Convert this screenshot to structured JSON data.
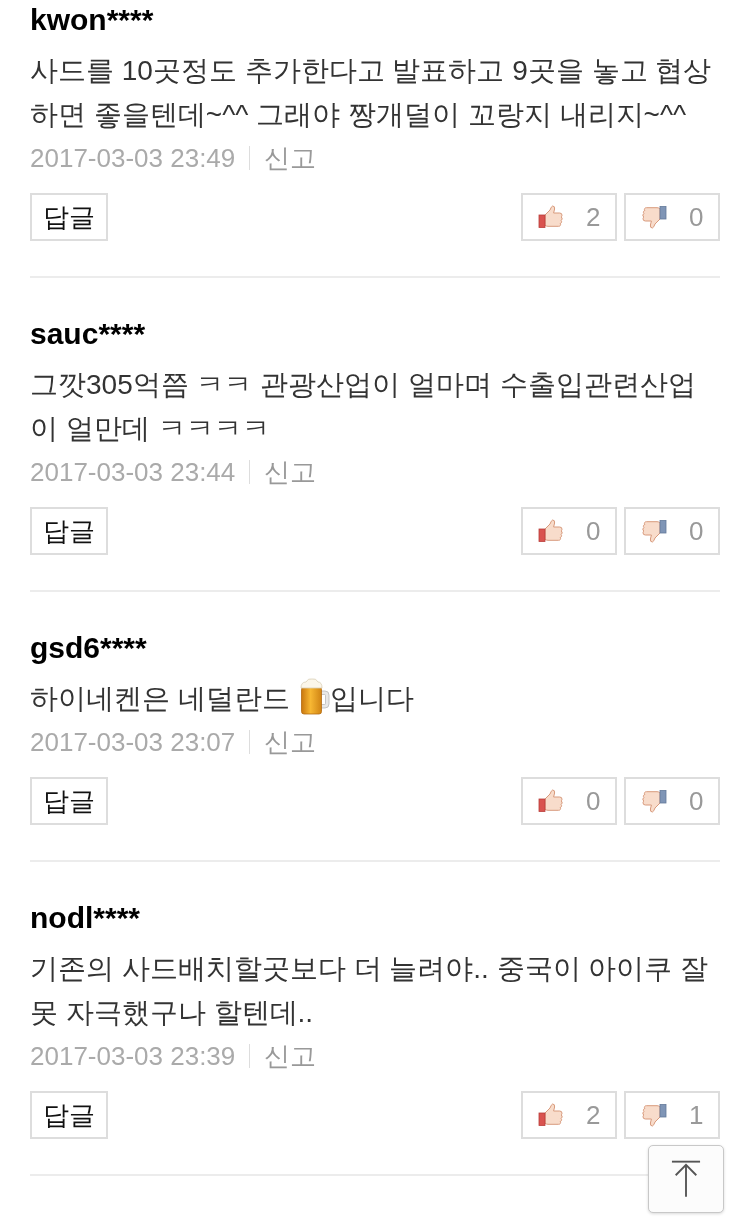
{
  "comments": [
    {
      "username": "kwon****",
      "body": [
        {
          "kind": "text",
          "text": "사드를 10곳정도 추가한다고 발표하고 9곳을 놓고 협상하면 좋을텐데~^^ 그래야 짱개덜이 꼬랑지 내리지~^^"
        }
      ],
      "date": "2017-03-03 23:49",
      "report": "신고",
      "reply": "답글",
      "likes": "2",
      "dislikes": "0"
    },
    {
      "username": "sauc****",
      "body": [
        {
          "kind": "text",
          "text": "그깟305억쯤 ㅋㅋ 관광산업이 얼마며 수출입관련산업이 얼만데 ㅋㅋㅋㅋ"
        }
      ],
      "date": "2017-03-03 23:44",
      "report": "신고",
      "reply": "답글",
      "likes": "0",
      "dislikes": "0"
    },
    {
      "username": "gsd6****",
      "body": [
        {
          "kind": "text",
          "text": "하이네켄은 네덜란드"
        },
        {
          "kind": "emoji"
        },
        {
          "kind": "text",
          "text": "입니다"
        }
      ],
      "date": "2017-03-03 23:07",
      "report": "신고",
      "reply": "답글",
      "likes": "0",
      "dislikes": "0"
    },
    {
      "username": "nodl****",
      "body": [
        {
          "kind": "text",
          "text": "기존의 사드배치할곳보다 더 늘려야.. 중국이 아이쿠 잘못 자극했구나 할텐데.."
        }
      ],
      "date": "2017-03-03 23:39",
      "report": "신고",
      "reply": "답글",
      "likes": "2",
      "dislikes": "1"
    }
  ]
}
